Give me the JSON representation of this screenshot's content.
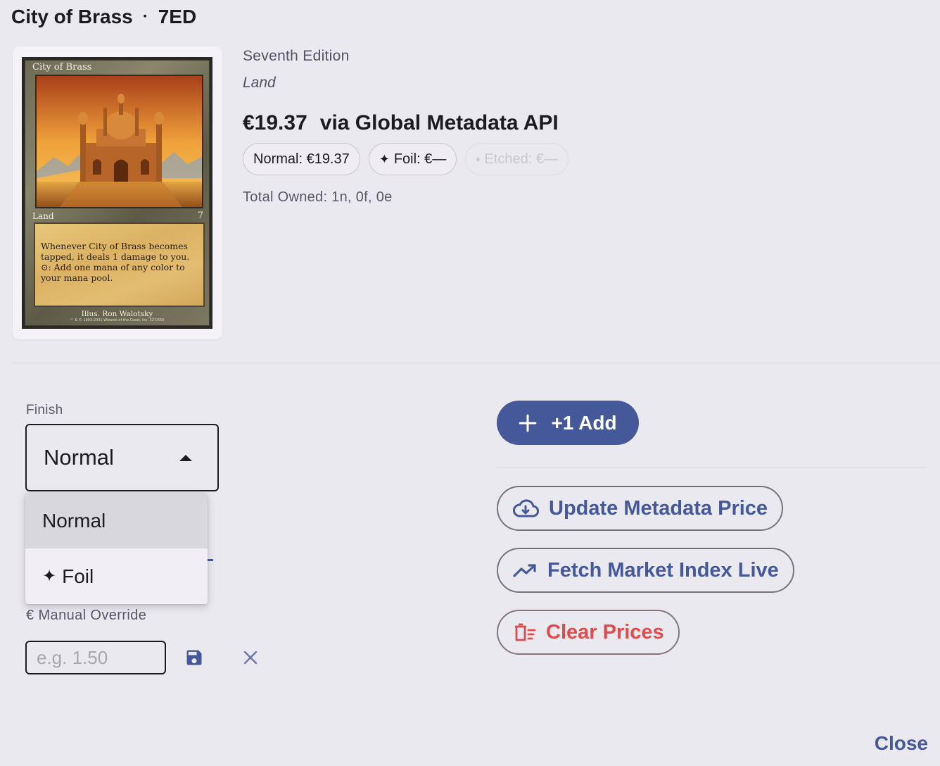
{
  "header": {
    "card_name": "City of Brass",
    "separator": "·",
    "set_code": "7ED"
  },
  "card_image": {
    "name": "City of Brass",
    "type": "Land",
    "set_symbol": "7",
    "rules_text_1": "Whenever City of Brass becomes tapped, it deals 1 damage to you.",
    "rules_text_2": ": Add one mana of any color to your mana pool.",
    "illustrator": "Illus. Ron Walotsky",
    "copyright": "™ & © 1993-2001 Wizards of the Coast, Inc. 327/350"
  },
  "info": {
    "set_name": "Seventh Edition",
    "type_line": "Land",
    "price": "€19.37",
    "price_source": "via Global Metadata API",
    "total_owned": "Total Owned: 1n, 0f, 0e"
  },
  "price_chips": [
    {
      "label": "Normal: €19.37",
      "icon": "",
      "disabled": false
    },
    {
      "label": "Foil: €—",
      "icon": "✦",
      "disabled": false
    },
    {
      "label": "Etched: €—",
      "icon": "♦",
      "disabled": true
    }
  ],
  "finish": {
    "label": "Finish",
    "selected": "Normal",
    "options": [
      {
        "label": "Normal",
        "icon": ""
      },
      {
        "label": "Foil",
        "icon": "✦"
      }
    ]
  },
  "override": {
    "label": "€ Manual Override",
    "placeholder": "e.g. 1.50",
    "value": ""
  },
  "actions": {
    "add_label": "+1 Add",
    "update_label": "Update Metadata Price",
    "fetch_label": "Fetch Market Index Live",
    "clear_label": "Clear Prices"
  },
  "footer": {
    "close_label": "Close"
  },
  "colors": {
    "primary": "#44589a",
    "danger": "#e04c4c",
    "background": "#ebe9f0"
  }
}
